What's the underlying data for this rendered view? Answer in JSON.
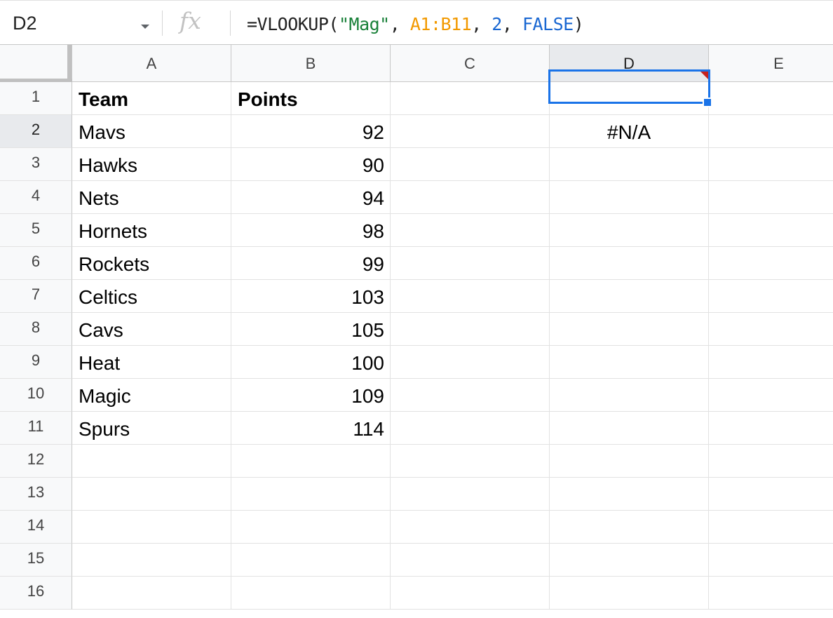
{
  "name_box": {
    "value": "D2"
  },
  "formula_bar": {
    "fx_label": "fx",
    "tokens": [
      {
        "text": "=VLOOKUP(",
        "kind": "plain"
      },
      {
        "text": "\"Mag\"",
        "kind": "str"
      },
      {
        "text": ", ",
        "kind": "plain"
      },
      {
        "text": "A1:B11",
        "kind": "range"
      },
      {
        "text": ", ",
        "kind": "plain"
      },
      {
        "text": "2",
        "kind": "num"
      },
      {
        "text": ", ",
        "kind": "plain"
      },
      {
        "text": "FALSE",
        "kind": "bool"
      },
      {
        "text": ")",
        "kind": "plain"
      }
    ]
  },
  "columns": [
    "A",
    "B",
    "C",
    "D",
    "E"
  ],
  "selected_column": "D",
  "rows": [
    "1",
    "2",
    "3",
    "4",
    "5",
    "6",
    "7",
    "8",
    "9",
    "10",
    "11",
    "12",
    "13",
    "14",
    "15",
    "16"
  ],
  "selected_row": "2",
  "cells": {
    "A1": "Team",
    "B1": "Points",
    "A2": "Mavs",
    "B2": "92",
    "D2": "#N/A",
    "A3": "Hawks",
    "B3": "90",
    "A4": "Nets",
    "B4": "94",
    "A5": "Hornets",
    "B5": "98",
    "A6": "Rockets",
    "B6": "99",
    "A7": "Celtics",
    "B7": "103",
    "A8": "Cavs",
    "B8": "105",
    "A9": "Heat",
    "B9": "100",
    "A10": "Magic",
    "B10": "109",
    "A11": "Spurs",
    "B11": "114"
  },
  "colors": {
    "selection": "#1a73e8",
    "error_flag": "#c5221f",
    "string_token": "#188038",
    "range_token": "#f29900",
    "number_token": "#1967d2"
  }
}
